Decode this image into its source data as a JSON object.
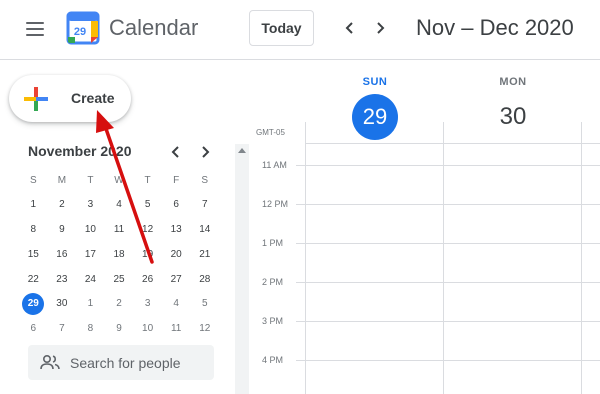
{
  "header": {
    "app_title": "Calendar",
    "logo_day": "29",
    "today_label": "Today",
    "date_range": "Nov – Dec 2020",
    "prev_icon": "chevron-left-icon",
    "next_icon": "chevron-right-icon"
  },
  "sidebar": {
    "create_label": "Create",
    "mini_calendar": {
      "title": "November 2020",
      "weekdays": [
        "S",
        "M",
        "T",
        "W",
        "T",
        "F",
        "S"
      ],
      "weeks": [
        [
          {
            "d": "1"
          },
          {
            "d": "2"
          },
          {
            "d": "3"
          },
          {
            "d": "4"
          },
          {
            "d": "5"
          },
          {
            "d": "6"
          },
          {
            "d": "7"
          }
        ],
        [
          {
            "d": "8"
          },
          {
            "d": "9"
          },
          {
            "d": "10"
          },
          {
            "d": "11"
          },
          {
            "d": "12"
          },
          {
            "d": "13"
          },
          {
            "d": "14"
          }
        ],
        [
          {
            "d": "15"
          },
          {
            "d": "16"
          },
          {
            "d": "17"
          },
          {
            "d": "18"
          },
          {
            "d": "19"
          },
          {
            "d": "20"
          },
          {
            "d": "21"
          }
        ],
        [
          {
            "d": "22"
          },
          {
            "d": "23"
          },
          {
            "d": "24"
          },
          {
            "d": "25"
          },
          {
            "d": "26"
          },
          {
            "d": "27"
          },
          {
            "d": "28"
          }
        ],
        [
          {
            "d": "29",
            "today": true
          },
          {
            "d": "30"
          },
          {
            "d": "1",
            "other": true
          },
          {
            "d": "2",
            "other": true
          },
          {
            "d": "3",
            "other": true
          },
          {
            "d": "4",
            "other": true
          },
          {
            "d": "5",
            "other": true
          }
        ],
        [
          {
            "d": "6",
            "other": true
          },
          {
            "d": "7",
            "other": true
          },
          {
            "d": "8",
            "other": true
          },
          {
            "d": "9",
            "other": true
          },
          {
            "d": "10",
            "other": true
          },
          {
            "d": "11",
            "other": true
          },
          {
            "d": "12",
            "other": true
          }
        ]
      ]
    },
    "search_people_placeholder": "Search for people"
  },
  "main": {
    "days": [
      {
        "dow": "SUN",
        "date": "29",
        "is_today": true
      },
      {
        "dow": "MON",
        "date": "30",
        "is_today": false
      }
    ],
    "timezone": "GMT-05",
    "hours": [
      "11 AM",
      "12 PM",
      "1 PM",
      "2 PM",
      "3 PM",
      "4 PM"
    ]
  },
  "colors": {
    "accent": "#1a73e8",
    "annotation_arrow": "#d60f0f",
    "plus_blue": "#4285f4",
    "plus_red": "#ea4335",
    "plus_yellow": "#fbbc04",
    "plus_green": "#34a853"
  }
}
